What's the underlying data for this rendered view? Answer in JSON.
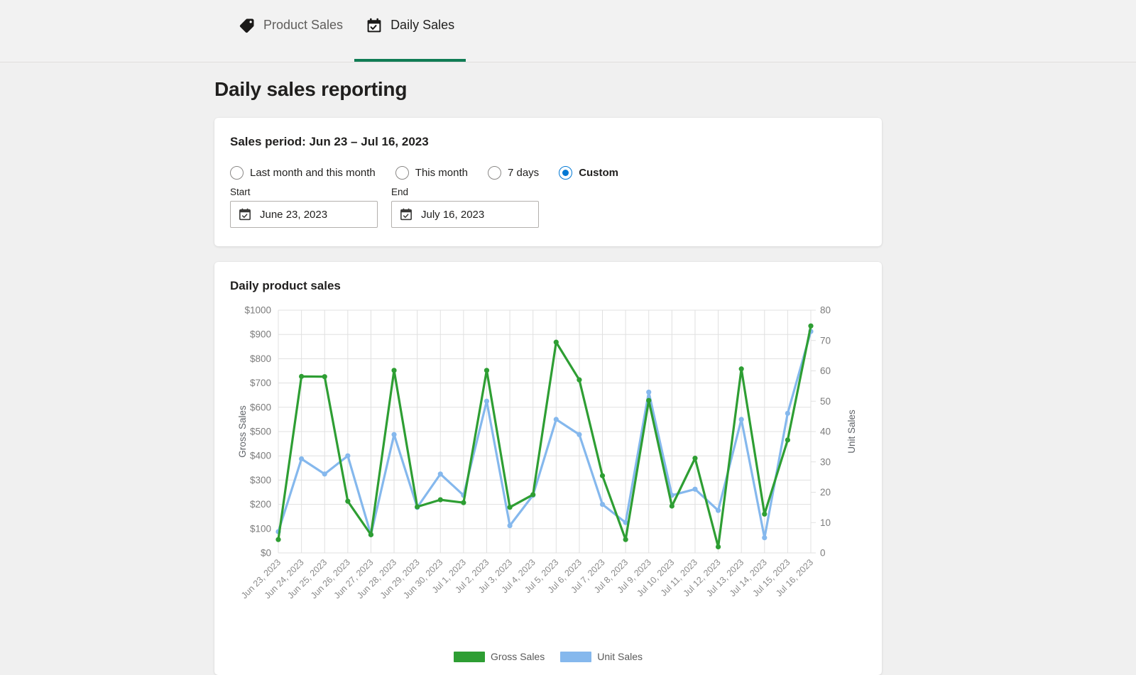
{
  "tabs": [
    {
      "label": "Product Sales",
      "icon": "tag-icon",
      "active": false
    },
    {
      "label": "Daily Sales",
      "icon": "calendar-check-icon",
      "active": true
    }
  ],
  "page_title": "Daily sales reporting",
  "filters": {
    "heading": "Sales period: Jun 23 – Jul 16, 2023",
    "radios": [
      {
        "label": "Last month and this month",
        "checked": false
      },
      {
        "label": "This month",
        "checked": false
      },
      {
        "label": "7 days",
        "checked": false
      },
      {
        "label": "Custom",
        "checked": true
      }
    ],
    "start": {
      "label": "Start",
      "value": "June 23, 2023",
      "icon": "calendar-check-icon"
    },
    "end": {
      "label": "End",
      "value": "July 16, 2023",
      "icon": "calendar-check-icon"
    }
  },
  "chart_card": {
    "heading": "Daily product sales"
  },
  "colors": {
    "gross_sales": "#2e9e33",
    "unit_sales": "#85b8ed",
    "accent_tab": "#107c55",
    "radio_selected": "#0078d4",
    "grid": "#e0e0e0"
  },
  "chart_data": {
    "type": "line",
    "title": "Daily product sales",
    "xlabel": "",
    "grid": true,
    "legend_position": "bottom",
    "categories": [
      "Jun 23, 2023",
      "Jun 24, 2023",
      "Jun 25, 2023",
      "Jun 26, 2023",
      "Jun 27, 2023",
      "Jun 28, 2023",
      "Jun 29, 2023",
      "Jun 30, 2023",
      "Jul 1, 2023",
      "Jul 2, 2023",
      "Jul 3, 2023",
      "Jul 4, 2023",
      "Jul 5, 2023",
      "Jul 6, 2023",
      "Jul 7, 2023",
      "Jul 8, 2023",
      "Jul 9, 2023",
      "Jul 10, 2023",
      "Jul 11, 2023",
      "Jul 12, 2023",
      "Jul 13, 2023",
      "Jul 14, 2023",
      "Jul 15, 2023",
      "Jul 16, 2023"
    ],
    "series": [
      {
        "name": "Gross Sales",
        "axis": "left",
        "color": "#2e9e33",
        "ylabel": "Gross Sales",
        "ylim": [
          0,
          1000
        ],
        "yticks": [
          "$0",
          "$100",
          "$200",
          "$300",
          "$400",
          "$500",
          "$600",
          "$700",
          "$800",
          "$900",
          "$1000"
        ],
        "values": [
          55,
          727,
          726,
          213,
          75,
          752,
          190,
          219,
          207,
          752,
          188,
          240,
          868,
          713,
          318,
          55,
          628,
          193,
          390,
          25,
          758,
          160,
          465,
          935
        ]
      },
      {
        "name": "Unit Sales",
        "axis": "right",
        "color": "#85b8ed",
        "ylabel": "Unit Sales",
        "ylim": [
          0,
          80
        ],
        "yticks": [
          "0",
          "10",
          "20",
          "30",
          "40",
          "50",
          "60",
          "70",
          "80"
        ],
        "values": [
          7,
          31,
          26,
          32,
          6,
          39,
          15,
          26,
          19,
          50,
          9,
          19,
          44,
          39,
          16,
          10,
          53,
          19,
          21,
          14,
          44,
          5,
          46,
          73
        ]
      }
    ]
  },
  "legend": [
    {
      "label": "Gross Sales",
      "color": "#2e9e33"
    },
    {
      "label": "Unit Sales",
      "color": "#85b8ed"
    }
  ]
}
